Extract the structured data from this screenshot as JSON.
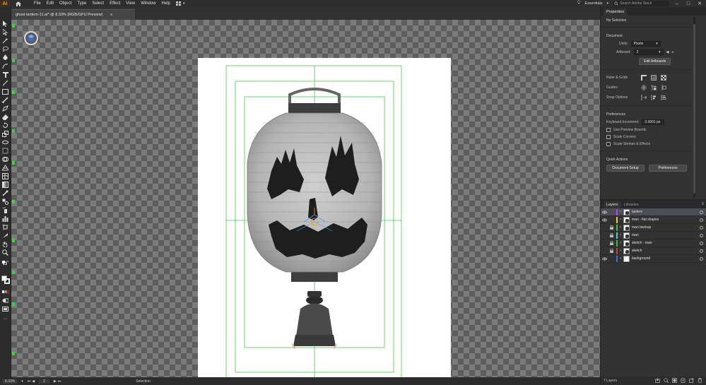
{
  "app": {
    "logo": "Ai",
    "menus": [
      "File",
      "Edit",
      "Object",
      "Type",
      "Select",
      "Effect",
      "View",
      "Window",
      "Help"
    ],
    "workspace": "Essentials",
    "search_placeholder": "Search Adobe Stock"
  },
  "document": {
    "tab_title": "ghost-lantern-11.ai* @ 8.33% (RGB/GPU Preview)"
  },
  "status": {
    "zoom": "8.33%",
    "artboard": "2",
    "tool": "Selection"
  },
  "properties": {
    "tabs": [
      "Properties"
    ],
    "selection": "No Selection",
    "document_title": "Document",
    "units_label": "Units:",
    "units_value": "Pixels",
    "artboard_label": "Artboard:",
    "artboard_value": "2",
    "edit_artboards": "Edit Artboards",
    "rulers_grids": "Ruler & Grids",
    "guides": "Guides",
    "snap_options": "Snap Options",
    "preferences_title": "Preferences",
    "keyboard_increment_label": "Keyboard Increment:",
    "keyboard_increment_value": "0.0001 px",
    "use_preview_bounds": "Use Preview Bounds",
    "scale_corners": "Scale Corners",
    "scale_strokes": "Scale Strokes & Effects",
    "quick_actions": "Quick Actions",
    "document_setup": "Document Setup",
    "preferences_button": "Preferences"
  },
  "layers": {
    "tabs": [
      "Layers",
      "Libraries"
    ],
    "items": [
      {
        "name": "lantern",
        "color": "#b04de0",
        "visible": true,
        "locked": false,
        "selected": true
      },
      {
        "name": "man - flat shapes",
        "color": "#e0d23a",
        "visible": true,
        "locked": false,
        "selected": false
      },
      {
        "name": "man backup",
        "color": "#3fbf3f",
        "visible": false,
        "locked": true,
        "selected": false
      },
      {
        "name": "man",
        "color": "#3fd6d6",
        "visible": false,
        "locked": true,
        "selected": false
      },
      {
        "name": "sketch - man",
        "color": "#3fbf3f",
        "visible": false,
        "locked": true,
        "selected": false
      },
      {
        "name": "sketch",
        "color": "#d63a3a",
        "visible": false,
        "locked": true,
        "selected": false
      },
      {
        "name": "background",
        "color": "#4a6cd6",
        "visible": true,
        "locked": false,
        "selected": false
      }
    ],
    "count": "7 Layers"
  },
  "colors": {
    "accent_green": "#3fcf3f",
    "panel_bg": "#323232",
    "selected_row": "#4b4e57"
  }
}
